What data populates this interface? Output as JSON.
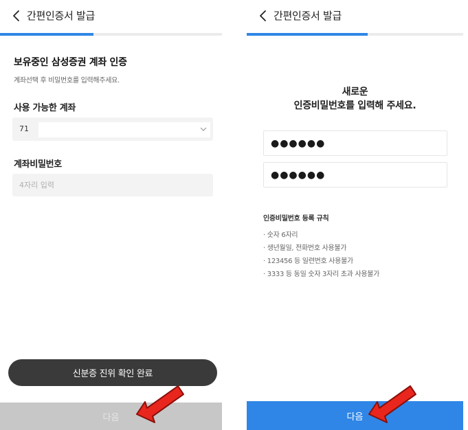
{
  "left_screen": {
    "header": {
      "title": "간편인증서 발급",
      "back_icon": "chevron-left-icon"
    },
    "progress_fraction": 0.42,
    "section_title": "보유중인 삼성증권 계좌 인증",
    "section_subtitle": "계좌선택 후 비밀번호를 입력해주세요.",
    "account": {
      "label": "사용 가능한 계좌",
      "selected_value": "71"
    },
    "password": {
      "label": "계좌비밀번호",
      "placeholder": "4자리 입력"
    },
    "id_verified_button": "신분증 진위 확인 완료",
    "next_button": "다음"
  },
  "right_screen": {
    "header": {
      "title": "간편인증서 발급",
      "back_icon": "chevron-left-icon"
    },
    "progress_fraction": 0.56,
    "prompt_line1": "새로운",
    "prompt_line2": "인증비밀번호를 입력해 주세요.",
    "pin_value": "●●●●●●",
    "pin_confirm_value": "●●●●●●",
    "rules_title": "인증비밀번호 등록 규칙",
    "rules": [
      "· 숫자 6자리",
      "· 생년월일, 전화번호 사용불가",
      "· 123456 등 일련번호 사용불가",
      "· 3333 등 동일 숫자 3자리 초과 사용불가"
    ],
    "next_button": "다음"
  },
  "colors": {
    "accent_blue": "#2f86e6",
    "disabled_gray": "#c7c7c7",
    "dark_pill": "#3a3a3a",
    "annotation_red": "#e8261d"
  }
}
